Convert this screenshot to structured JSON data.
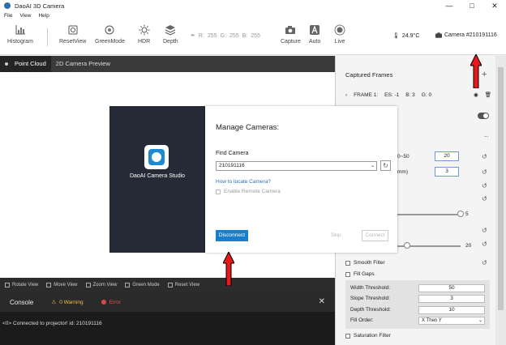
{
  "window": {
    "title": "DaoAI 3D Camera",
    "minimize": "—",
    "maximize": "□",
    "close": "✕"
  },
  "menu": [
    "File",
    "View",
    "Help"
  ],
  "toolbar": {
    "histogram": "Histogram",
    "reset_view": "ResetView",
    "green_mode": "GreenMode",
    "hdr": "HDR",
    "depth": "Depth",
    "rgb": {
      "r_label": "R:",
      "r": "255",
      "g_label": "G:",
      "g": "255",
      "b_label": "B:",
      "b": "255"
    },
    "capture": "Capture",
    "auto": "Auto",
    "live": "Live",
    "temperature": "24.9°C",
    "camera_id": "Camera #210191116"
  },
  "view_tabs": {
    "point_cloud": "Point Cloud",
    "camera_preview": "2D Camera Preview"
  },
  "view_bar": [
    "Rotate View",
    "Move View",
    "Zoom View",
    "Green Mode",
    "Reset View"
  ],
  "console": {
    "title": "Console",
    "warning": "0 Warning",
    "error": "Error",
    "close": "✕",
    "line": "<0> Connected to projector! id: 210191116"
  },
  "right_panel": {
    "captured_frames": "Captured Frames",
    "plus": "+",
    "frame": {
      "name": "FRAME 1:",
      "es": "ES: -1",
      "b": "B: 3",
      "g": "G: 0"
    },
    "more": "...",
    "range_label": "0~50",
    "range_value": "20",
    "mm_label": "mm)",
    "mm_value": "3",
    "slider1_value": "5",
    "slider2_value": "20",
    "smooth_filter": "Smooth Filter",
    "fill_gaps": "Fill Gaps",
    "width_threshold": {
      "label": "Width Threshold:",
      "value": "50"
    },
    "slope_threshold": {
      "label": "Slope Threshold:",
      "value": "3"
    },
    "depth_threshold": {
      "label": "Depth Threshold:",
      "value": "10"
    },
    "fill_order": {
      "label": "Fill Order:",
      "value": "X Then Y"
    },
    "saturation_filter": "Saturation Filter"
  },
  "dialog": {
    "studio_name": "DaoAI Camera Studio",
    "title": "Manage Cameras:",
    "find_camera": "Find Camera",
    "camera_value": "210191116",
    "how_to_locate": "How to locate Camera?",
    "enable_remote": "Enable Remote Camera",
    "disconnect": "Disconnect",
    "skip": "Skip",
    "connect": "Connect"
  },
  "colors": {
    "accent": "#1a7fc8",
    "arrow": "#e8191b",
    "dark_panel": "#252a36"
  }
}
